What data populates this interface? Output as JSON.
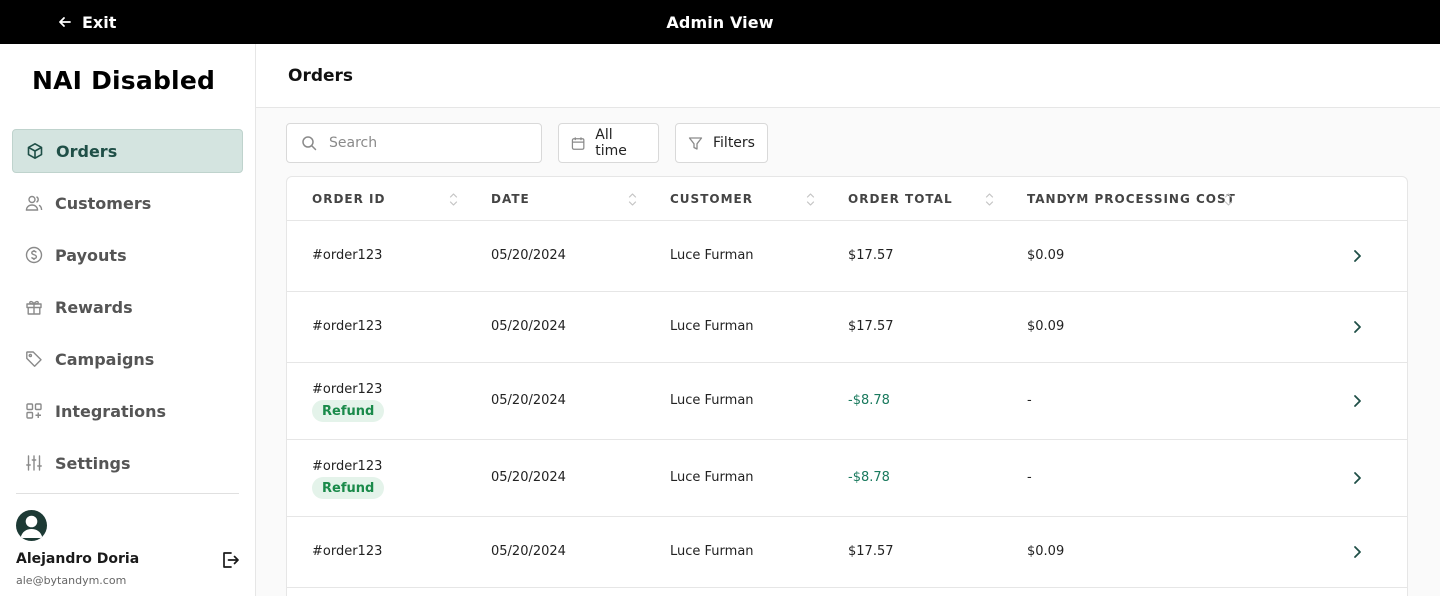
{
  "topbar": {
    "exit_label": "Exit",
    "title": "Admin View"
  },
  "sidebar": {
    "brand": "NAI Disabled",
    "items": [
      {
        "label": "Orders",
        "icon": "box-icon",
        "active": true
      },
      {
        "label": "Customers",
        "icon": "users-icon"
      },
      {
        "label": "Payouts",
        "icon": "dollar-circle-icon"
      },
      {
        "label": "Rewards",
        "icon": "gift-icon"
      },
      {
        "label": "Campaigns",
        "icon": "tag-icon"
      },
      {
        "label": "Integrations",
        "icon": "apps-icon"
      },
      {
        "label": "Settings",
        "icon": "sliders-icon"
      }
    ],
    "user": {
      "name": "Alejandro Doria",
      "email": "ale@bytandym.com"
    }
  },
  "main": {
    "title": "Orders",
    "search_placeholder": "Search",
    "date_filter": "All time",
    "filters_label": "Filters"
  },
  "table": {
    "columns": [
      "ORDER ID",
      "DATE",
      "CUSTOMER",
      "ORDER TOTAL",
      "TANDYM PROCESSING COST"
    ],
    "rows": [
      {
        "order_id": "#order123",
        "badge": "",
        "date": "05/20/2024",
        "customer": "Luce Furman",
        "total": "$17.57",
        "cost": "$0.09"
      },
      {
        "order_id": "#order123",
        "badge": "",
        "date": "05/20/2024",
        "customer": "Luce Furman",
        "total": "$17.57",
        "cost": "$0.09"
      },
      {
        "order_id": "#order123",
        "badge": "Refund",
        "date": "05/20/2024",
        "customer": "Luce Furman",
        "total": "-$8.78",
        "cost": "-"
      },
      {
        "order_id": "#order123",
        "badge": "Refund",
        "date": "05/20/2024",
        "customer": "Luce Furman",
        "total": "-$8.78",
        "cost": "-"
      },
      {
        "order_id": "#order123",
        "badge": "",
        "date": "05/20/2024",
        "customer": "Luce Furman",
        "total": "$17.57",
        "cost": "$0.09"
      }
    ]
  },
  "colors": {
    "accent": "#1f4f47",
    "active_bg": "#d4e4e0",
    "refund_text": "#1a8a4a",
    "negative_total": "#1a7a5e"
  }
}
